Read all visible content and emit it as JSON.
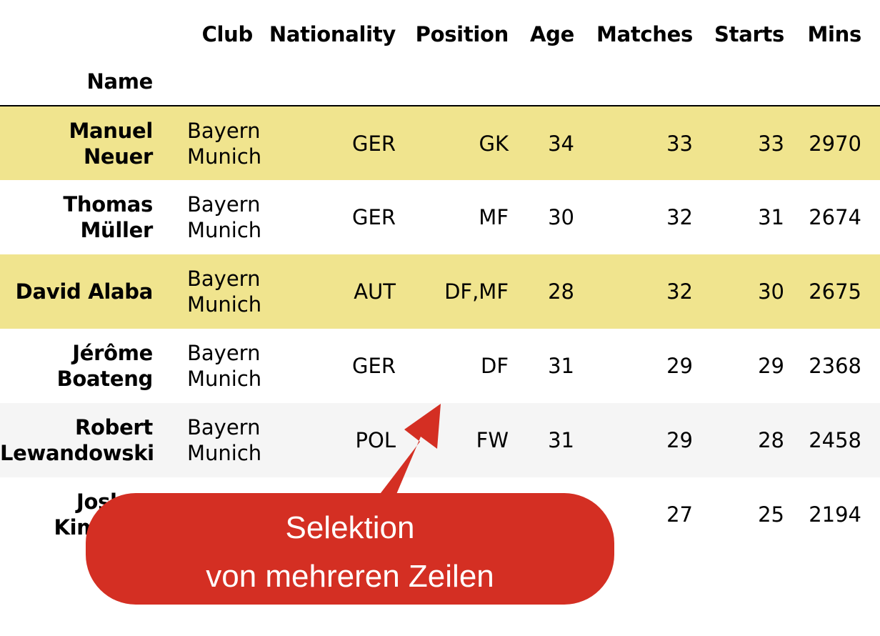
{
  "table": {
    "columns": [
      "Club",
      "Nationality",
      "Position",
      "Age",
      "Matches",
      "Starts",
      "Mins"
    ],
    "index_name": "Name",
    "rows": [
      {
        "name": "Manuel Neuer",
        "club": "Bayern Munich",
        "nationality": "GER",
        "position": "GK",
        "age": "34",
        "matches": "33",
        "starts": "33",
        "mins": "2970",
        "highlight": true
      },
      {
        "name": "Thomas Müller",
        "club": "Bayern Munich",
        "nationality": "GER",
        "position": "MF",
        "age": "30",
        "matches": "32",
        "starts": "31",
        "mins": "2674",
        "highlight": false
      },
      {
        "name": "David Alaba",
        "club": "Bayern Munich",
        "nationality": "AUT",
        "position": "DF,MF",
        "age": "28",
        "matches": "32",
        "starts": "30",
        "mins": "2675",
        "highlight": true
      },
      {
        "name": "Jérôme Boateng",
        "club": "Bayern Munich",
        "nationality": "GER",
        "position": "DF",
        "age": "31",
        "matches": "29",
        "starts": "29",
        "mins": "2368",
        "highlight": false
      },
      {
        "name": "Robert Lewandowski",
        "club": "Bayern Munich",
        "nationality": "POL",
        "position": "FW",
        "age": "31",
        "matches": "29",
        "starts": "28",
        "mins": "2458",
        "highlight": false
      },
      {
        "name": "Joshua Kimmich",
        "club": "",
        "nationality": "",
        "position": "",
        "age": "",
        "matches": "27",
        "starts": "25",
        "mins": "2194",
        "highlight": false
      }
    ]
  },
  "callout": {
    "line1": "Selektion",
    "line2": "von mehreren Zeilen"
  },
  "colors": {
    "highlight_row": "#f0e48e",
    "alt_row": "#f5f5f5",
    "callout": "#d42f23"
  }
}
